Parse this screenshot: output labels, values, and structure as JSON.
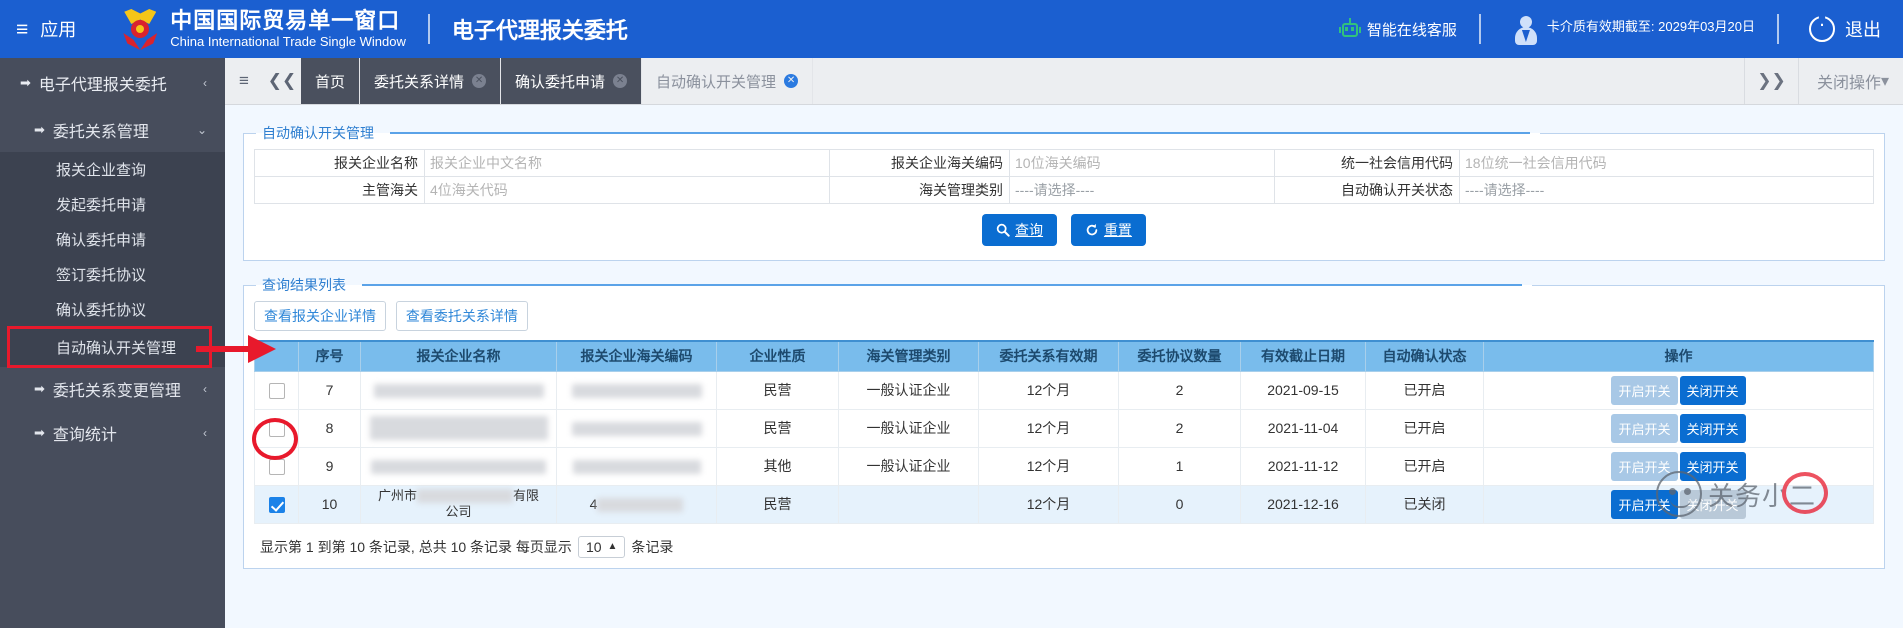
{
  "header": {
    "apps_label": "应用",
    "brand_cn": "中国国际贸易单一窗口",
    "brand_en": "China International Trade Single Window",
    "module_title": "电子代理报关委托",
    "service_label": "智能在线客服",
    "card_validity": "卡介质有效期截至: 2029年03月20日",
    "logout_label": "退出",
    "divider": "|"
  },
  "sidebar": {
    "root": {
      "label": "电子代理报关委托",
      "chevron": "‹"
    },
    "group": {
      "label": "委托关系管理",
      "chevron": "⌄"
    },
    "items": [
      {
        "label": "报关企业查询"
      },
      {
        "label": "发起委托申请"
      },
      {
        "label": "确认委托申请"
      },
      {
        "label": "签订委托协议"
      },
      {
        "label": "确认委托协议"
      },
      {
        "label": "自动确认开关管理"
      }
    ],
    "tail": [
      {
        "label": "委托关系变更管理",
        "chevron": "‹"
      },
      {
        "label": "查询统计",
        "chevron": "‹"
      }
    ]
  },
  "tabbar": {
    "menu_icon": "≡",
    "back_icon": "❮❮",
    "forward_icon": "❯❯",
    "close_ops_label": "关闭操作",
    "close_ops_caret": "▾",
    "tabs": [
      {
        "label": "首页",
        "closable": false,
        "active": false
      },
      {
        "label": "委托关系详情",
        "closable": true,
        "active": false
      },
      {
        "label": "确认委托申请",
        "closable": true,
        "active": false
      },
      {
        "label": "自动确认开关管理",
        "closable": true,
        "active": true
      }
    ],
    "close_glyph": "✕"
  },
  "search_panel": {
    "legend": "自动确认开关管理",
    "fields": [
      {
        "label": "报关企业名称",
        "placeholder": "报关企业中文名称",
        "type": "text"
      },
      {
        "label": "报关企业海关编码",
        "placeholder": "10位海关编码",
        "type": "text"
      },
      {
        "label": "统一社会信用代码",
        "placeholder": "18位统一社会信用代码",
        "type": "text"
      },
      {
        "label": "主管海关",
        "placeholder": "4位海关代码",
        "type": "text"
      },
      {
        "label": "海关管理类别",
        "placeholder": "----请选择----",
        "type": "select"
      },
      {
        "label": "自动确认开关状态",
        "placeholder": "----请选择----",
        "type": "select"
      }
    ],
    "buttons": {
      "search": "查询",
      "search_icon": "🔍",
      "reset": "重置",
      "reset_icon": "↺"
    }
  },
  "result_panel": {
    "legend": "查询结果列表",
    "toolbar": [
      {
        "label": "查看报关企业详情"
      },
      {
        "label": "查看委托关系详情"
      }
    ],
    "columns": [
      "序号",
      "报关企业名称",
      "报关企业海关编码",
      "企业性质",
      "海关管理类别",
      "委托关系有效期",
      "委托协议数量",
      "有效截止日期",
      "自动确认状态",
      "操作"
    ],
    "rows": [
      {
        "checked": false,
        "seq": "7",
        "company": "",
        "company_redacted": true,
        "customs_code": "",
        "code_redacted": true,
        "nature": "民营",
        "category": "一般认证企业",
        "validity": "12个月",
        "agreements": "2",
        "deadline": "2021-09-15",
        "status": "已开启",
        "actions": [
          {
            "label": "开启开关",
            "style": "on"
          },
          {
            "label": "关闭开关",
            "style": "off"
          }
        ]
      },
      {
        "checked": false,
        "seq": "8",
        "company": "",
        "company_redacted": true,
        "customs_code": "",
        "code_redacted": true,
        "nature": "民营",
        "category": "一般认证企业",
        "validity": "12个月",
        "agreements": "2",
        "deadline": "2021-11-04",
        "status": "已开启",
        "actions": [
          {
            "label": "开启开关",
            "style": "on"
          },
          {
            "label": "关闭开关",
            "style": "off"
          }
        ]
      },
      {
        "checked": false,
        "seq": "9",
        "company": "",
        "company_redacted": true,
        "customs_code": "",
        "code_redacted": true,
        "nature": "其他",
        "category": "一般认证企业",
        "validity": "12个月",
        "agreements": "1",
        "deadline": "2021-11-12",
        "status": "已开启",
        "actions": [
          {
            "label": "开启开关",
            "style": "on"
          },
          {
            "label": "关闭开关",
            "style": "off"
          }
        ]
      },
      {
        "checked": true,
        "seq": "10",
        "company": "广州市█████████有限公司",
        "company_prefix": "广州市",
        "company_suffix": "有限",
        "company_line2": "公司",
        "company_redacted": true,
        "customs_code": "4",
        "code_redacted": true,
        "nature": "民营",
        "category": "",
        "validity": "12个月",
        "agreements": "0",
        "deadline": "2021-12-16",
        "status": "已关闭",
        "actions": [
          {
            "label": "开启开关",
            "style": "off"
          },
          {
            "label": "关闭开关",
            "style": "dim"
          }
        ]
      }
    ],
    "footer": {
      "text_before": "显示第 1 到第 10 条记录, 总共 10 条记录 每页显示",
      "page_size": "10",
      "caret": "▲",
      "text_after": "条记录"
    }
  },
  "watermark": {
    "text": "关务小二"
  }
}
